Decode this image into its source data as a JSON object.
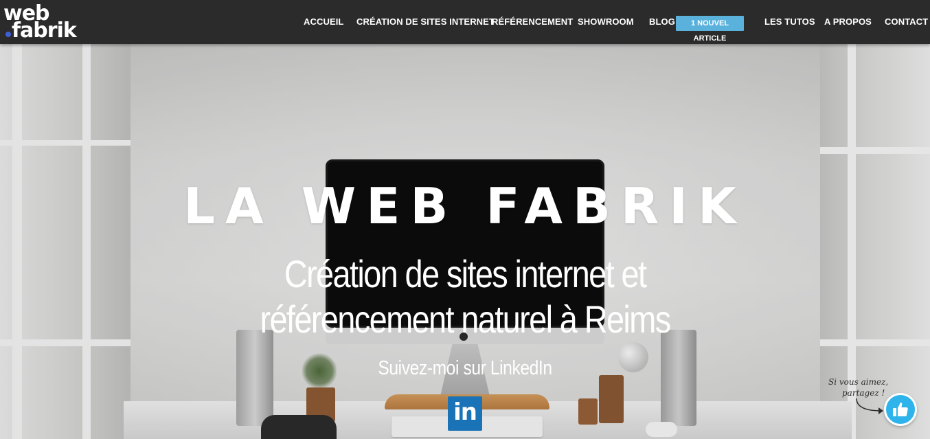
{
  "logo": {
    "line1": "web",
    "line2": "fabrik"
  },
  "nav": {
    "items": [
      {
        "label": "ACCUEIL"
      },
      {
        "label": "CRÉATION DE SITES INTERNET"
      },
      {
        "label": "RÉFÉRENCEMENT"
      },
      {
        "label": "SHOWROOM"
      },
      {
        "label": "BLOG"
      },
      {
        "label": "LES TUTOS"
      },
      {
        "label": "A PROPOS"
      },
      {
        "label": "CONTACT"
      }
    ],
    "blog_badge": "1 NOUVEL ARTICLE"
  },
  "hero": {
    "title": "LA WEB FABRIK",
    "subtitle": "Création de sites internet et référencement naturel à Reims",
    "follow": "Suivez-moi sur LinkedIn",
    "linkedin_icon": "linkedin-icon",
    "linkedin_glyph": "in"
  },
  "share": {
    "note_line1": "Si vous aimez,",
    "note_line2": "partagez !",
    "button_icon": "thumbs-up-icon"
  },
  "colors": {
    "navbar": "#2b2b2b",
    "badge": "#5ab1dc",
    "linkedin": "#1a73b6",
    "share_button": "#2eb4ea",
    "logo_dot": "#3e5fd6"
  }
}
